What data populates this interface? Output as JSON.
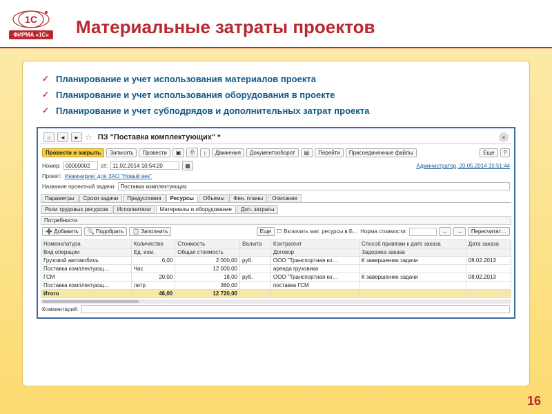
{
  "logo_label": "ФИРМА «1С»",
  "slide_title": "Материальные затраты проектов",
  "bullets": [
    "Планирование и учет использования материалов проекта",
    "Планирование и учет использования оборудования в проекте",
    "Планирование и учет субподрядов и дополнительных затрат проекта"
  ],
  "window": {
    "title": "ПЗ \"Поставка комплектующих\" *",
    "toolbar": {
      "primary": "Провести и закрыть",
      "save": "Записать",
      "post": "Провести",
      "movements": "Движения",
      "docflow": "Документооборот",
      "goto": "Перейти",
      "attached": "Присоединенные файлы",
      "more": "Еще",
      "help": "?"
    },
    "row1": {
      "num_lbl": "Номер:",
      "num_val": "00000002",
      "date_lbl": "от:",
      "date_val": "11.02.2014 10:54:20",
      "user_link": "Администратор, 20.05.2014 15:51:44"
    },
    "row2": {
      "proj_lbl": "Проект:",
      "proj_val": "Инжиниринг для ЗАО \"Новый век\""
    },
    "row3": {
      "task_lbl": "Название проектной задачи:",
      "task_val": "Поставка комплектующих"
    },
    "tabs": [
      "Параметры",
      "Сроки задачи",
      "Предусловия",
      "Ресурсы",
      "Объемы",
      "Фин. планы",
      "Описание"
    ],
    "subtabs": [
      "Роли трудовых ресурсов",
      "Исполнители",
      "Материалы и оборудование",
      "Доп. затраты"
    ],
    "section": "Потребности",
    "gridbar": {
      "add": "Добавить",
      "pick": "Подобрать",
      "fill": "Заполнить",
      "more": "Еще",
      "chk": "Включить мат. ресурсы в Б…",
      "norm": "Норма стоимости:",
      "recalc": "Пересчитат…"
    },
    "headers": {
      "h1a": "Номенклатура",
      "h1b": "Количество",
      "h1c": "Стоимость",
      "h1d": "Валюта",
      "h1e": "Контрагент",
      "h1f": "Способ привязки к дате заказа",
      "h1g": "Дата заказа",
      "h2a": "Вид операции",
      "h2b": "Ед. изм.",
      "h2c": "Общая стоимость",
      "h2e": "Договор",
      "h2f": "Задержка заказа"
    },
    "rows": [
      {
        "c1": "Грузовой автомобиль",
        "c2": "6,00",
        "c3": "2 000,00",
        "c4": "руб.",
        "c5": "ООО \"Транспортная ко…",
        "c6": "К завершению задачи",
        "c7": "08.02.2013",
        "s1": "Поставка комплектующ…",
        "s2": "Час",
        "s3": "12 000,00",
        "s5": "аренда грузовика"
      },
      {
        "c1": "ГСМ",
        "c2": "20,00",
        "c3": "18,00",
        "c4": "руб.",
        "c5": "ООО \"Транспортная ко…",
        "c6": "К завершению задачи",
        "c7": "08.02.2013",
        "s1": "Поставка комплектующ…",
        "s2": "литр",
        "s3": "360,00",
        "s5": "поставка ГСМ"
      }
    ],
    "total": {
      "lbl": "Итого",
      "qty": "46,00",
      "sum": "12 720,00"
    },
    "comment_lbl": "Комментарий:"
  },
  "page_num": "16"
}
